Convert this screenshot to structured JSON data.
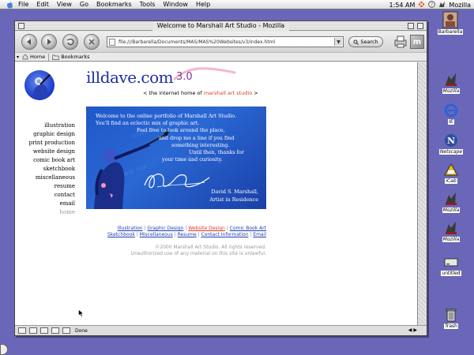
{
  "menubar": {
    "items": [
      "File",
      "Edit",
      "View",
      "Go",
      "Bookmarks",
      "Tools",
      "Window",
      "Help"
    ],
    "clock": "1:54 AM",
    "app_name": "Mozilla"
  },
  "desktop": {
    "icons": [
      {
        "label": "Barbarella",
        "icon": "hard-drive-icon"
      },
      {
        "label": "Mozilla",
        "icon": "mozilla-icon"
      },
      {
        "label": "IE",
        "icon": "internet-explorer-icon"
      },
      {
        "label": "Netscape",
        "icon": "netscape-icon"
      },
      {
        "label": "iCab",
        "icon": "icab-icon"
      },
      {
        "label": "Mozilla",
        "icon": "mozilla-alias-icon"
      },
      {
        "label": "Mozilla",
        "icon": "mozilla-alias-2-icon"
      },
      {
        "label": "untitled",
        "icon": "disk-icon"
      },
      {
        "label": "Trash",
        "icon": "trash-icon"
      }
    ]
  },
  "window": {
    "title": "Welcome to Marshall Art Studio - Mozilla",
    "url": "file:///Barbarella/Documents/MAS/MAS%20Websites/v3/index.html",
    "search_label": "Search",
    "personal_toolbar": [
      "Home",
      "Bookmarks"
    ],
    "status": "Done"
  },
  "page": {
    "logo": "illdave.com",
    "version": "3.0",
    "subtitle_prefix": "< the internet home of ",
    "subtitle_brand": "marshall art studio",
    "subtitle_suffix": " >",
    "nav": [
      "illustration",
      "graphic design",
      "print production",
      "website design",
      "comic book art",
      "sketchbook",
      "miscellaneous",
      "resume",
      "contact",
      "email",
      "home"
    ],
    "banner_lines": [
      "Welcome to the online portfolio of Marshall Art Studio.",
      "You'll find an eclectic mix of graphic art.",
      "Feel free to look around the place,",
      "and drop me a line if you find",
      "something interesting.",
      "Until then, thanks for",
      "your time and curiosity."
    ],
    "banner_name": "David S. Marshall,",
    "banner_role": "Artist in Residence",
    "links_row1": [
      "Illustration",
      "Graphic Design",
      "Website Design",
      "Comic Book Art"
    ],
    "links_row2": [
      "Sketchbook",
      "Miscellaneous",
      "Resume",
      "Contact Information",
      "Email"
    ],
    "link_sep": " | ",
    "copyright": "©2000 Marshall Art Studio. All rights reserved.",
    "notice": "Unauthorized use of any material on this site is unlawful."
  },
  "colors": {
    "desktop": "#6a67b8",
    "logo_blue": "#1f2fa5",
    "brand_red": "#d83b2a",
    "banner_blue": "#2a68d4"
  }
}
